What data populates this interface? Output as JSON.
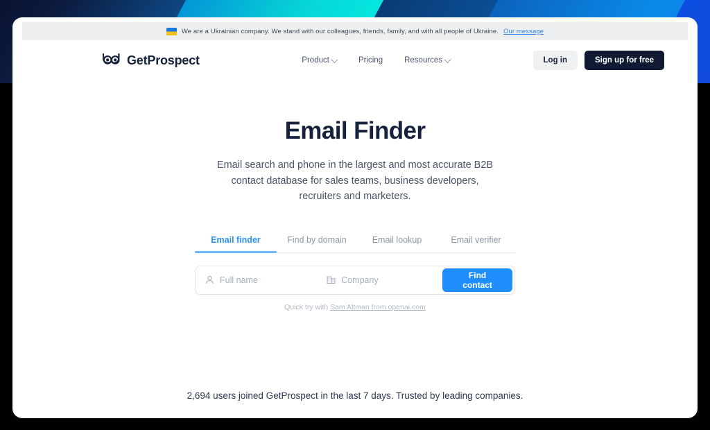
{
  "banner": {
    "flag_icon": "ukraine-flag-icon",
    "text": "We are a Ukrainian company. We stand with our colleagues, friends, family, and with all people of Ukraine.",
    "link_label": "Our message"
  },
  "header": {
    "logo_icon": "owl-logo-icon",
    "brand": "GetProspect",
    "nav": [
      {
        "label": "Product",
        "has_chevron": true
      },
      {
        "label": "Pricing",
        "has_chevron": false
      },
      {
        "label": "Resources",
        "has_chevron": true
      }
    ],
    "login_label": "Log in",
    "signup_label": "Sign up for free"
  },
  "hero": {
    "title": "Email Finder",
    "subtitle": "Email search and phone in the largest and most accurate B2B contact database for sales teams, business developers, recruiters and marketers."
  },
  "tabs": [
    {
      "label": "Email finder",
      "active": true
    },
    {
      "label": "Find by domain",
      "active": false
    },
    {
      "label": "Email lookup",
      "active": false
    },
    {
      "label": "Email verifier",
      "active": false
    }
  ],
  "search": {
    "name_icon": "person-icon",
    "name_placeholder": "Full name",
    "name_value": "",
    "company_icon": "building-icon",
    "company_placeholder": "Company",
    "company_value": "",
    "submit_label": "Find contact"
  },
  "quick_try": {
    "prefix": "Quick try with ",
    "link_label": "Sam Altman from openai.com"
  },
  "footer": {
    "note": "2,694 users joined GetProspect in the last 7 days. Trusted by leading companies."
  },
  "colors": {
    "accent_blue": "#1f8efc",
    "tab_active": "#2b92fb",
    "dark_navy": "#101b33",
    "banner_bg": "#eeeff1"
  }
}
